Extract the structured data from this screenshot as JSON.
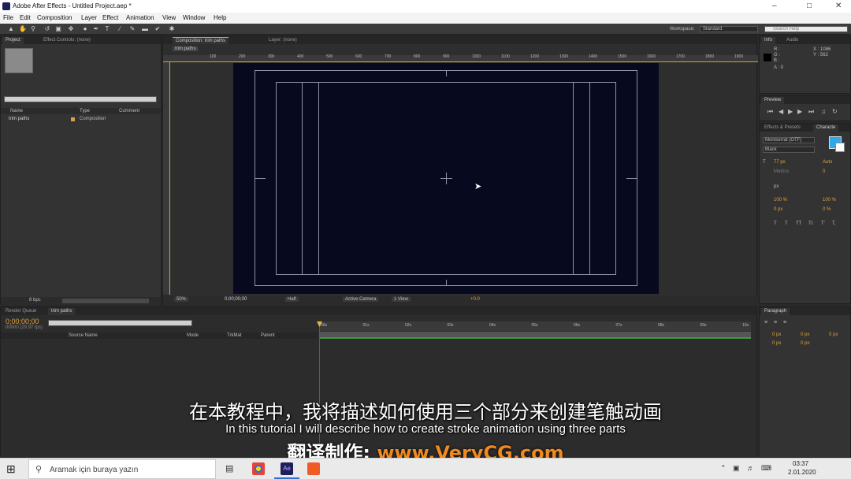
{
  "window": {
    "title": "Adobe After Effects - Untitled Project.aep *",
    "logo": "Ae"
  },
  "menu": [
    "File",
    "Edit",
    "Composition",
    "Layer",
    "Effect",
    "Animation",
    "View",
    "Window",
    "Help"
  ],
  "toolbar": {
    "workspace_label": "Workspace:",
    "workspace_value": "Standard",
    "search_placeholder": "Search Help"
  },
  "project": {
    "tab": "Project",
    "effect_tab": "Effect Controls: (none)",
    "columns": [
      "Name",
      "Type",
      "Comment"
    ],
    "items": [
      {
        "name": "trim paths",
        "type": "Composition"
      }
    ],
    "bpc": "8 bpc"
  },
  "composition": {
    "tab": "Composition: trim paths",
    "layer_tab": "Layer: (none)",
    "comp_name": "trim paths",
    "ruler_ticks": [
      "100",
      "200",
      "300",
      "400",
      "500",
      "600",
      "700",
      "800",
      "900",
      "1000",
      "1100",
      "1200",
      "1300",
      "1400",
      "1500",
      "1600",
      "1700",
      "1800",
      "1900"
    ],
    "zoom": "50%",
    "timecode": "0;00;00;00",
    "resolution": "Half",
    "camera": "Active Camera",
    "view": "1 View",
    "exposure": "+0.0"
  },
  "info": {
    "tab": "Info",
    "audio_tab": "Audio",
    "r": "R :",
    "g": "G :",
    "b": "B :",
    "a": "A : 0",
    "x": "X : 1086",
    "y": "Y : 562"
  },
  "preview": {
    "tab": "Preview"
  },
  "character": {
    "effects_tab": "Effects & Presets",
    "char_tab": "Characte",
    "font": "Montserrat (OTF)",
    "style": "Black",
    "size": "77 px",
    "leading": "Auto",
    "kerning": "Metrics",
    "tracking": "0",
    "stroke": "px",
    "vscale": "100 %",
    "hscale": "100 %",
    "baseline": "0 px",
    "tsume": "0 %",
    "styles": [
      "T",
      "T",
      "TT",
      "Tt",
      "T'",
      "T,"
    ],
    "fill_color": "#2ea8ea"
  },
  "paragraph": {
    "tab": "Paragraph",
    "indent": [
      "0 px",
      "0 px",
      "0 px",
      "0 px",
      "0 px"
    ]
  },
  "timeline": {
    "render_tab": "Render Queue",
    "comp_tab": "trim paths",
    "timecode": "0;00;00;00",
    "fps": "00000 (29.97 fps)",
    "columns": [
      "Source Name",
      "Mode",
      "TrkMat",
      "Parent"
    ],
    "time_marks": [
      "00s",
      "01s",
      "02s",
      "03s",
      "04s",
      "05s",
      "06s",
      "07s",
      "08s",
      "09s",
      "10s"
    ]
  },
  "subtitles": {
    "cn": "在本教程中，我将描述如何使用三个部分来创建笔触动画",
    "en": "In this tutorial I will describe how to create stroke animation using three parts",
    "credit_label": "翻译制作: ",
    "credit_url": "www.VeryCG.com"
  },
  "taskbar": {
    "search_placeholder": "Aramak için buraya yazın",
    "time": "03:37",
    "date": "2.01.2020"
  }
}
